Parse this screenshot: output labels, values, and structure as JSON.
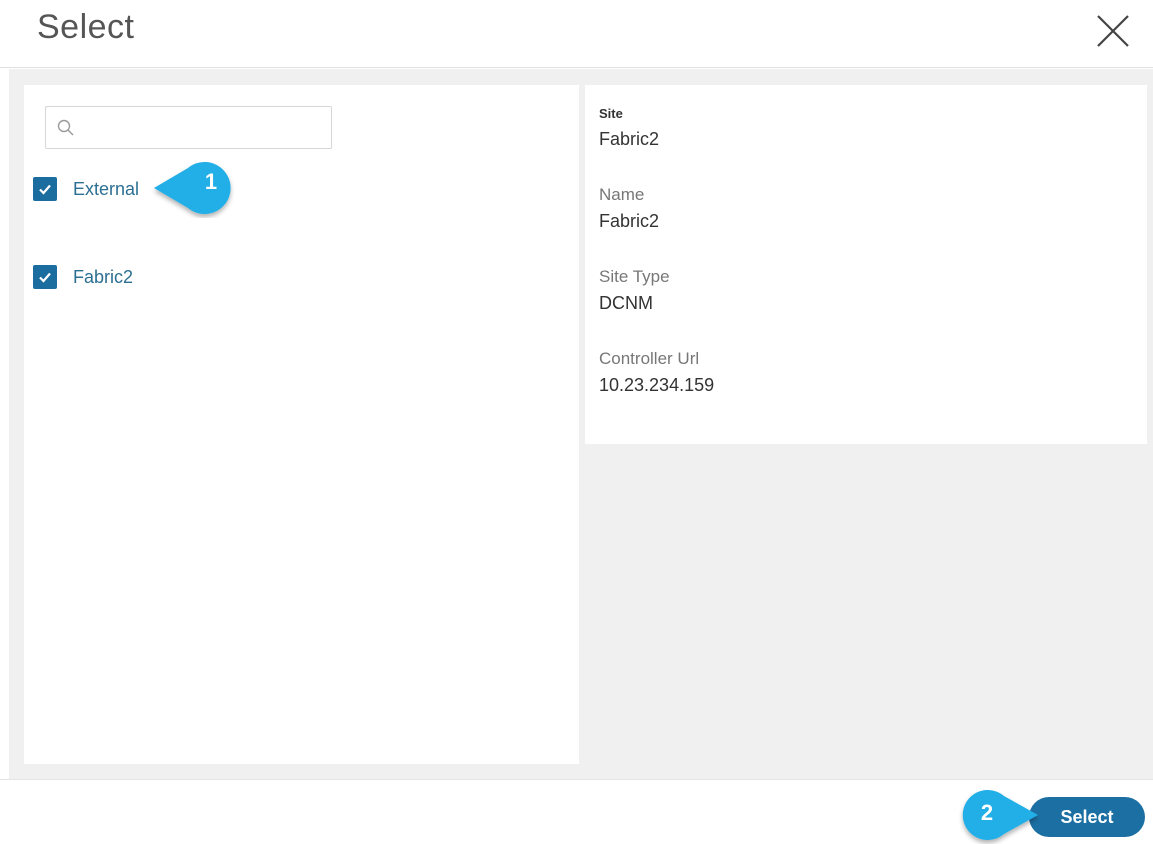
{
  "dialog": {
    "title": "Select",
    "close_icon": "close-icon"
  },
  "search": {
    "placeholder": "",
    "value": "",
    "icon": "search-icon"
  },
  "sites_list": [
    {
      "label": "External",
      "checked": true
    },
    {
      "label": "Fabric2",
      "checked": true
    }
  ],
  "details": {
    "site_label": "Site",
    "site_value": "Fabric2",
    "name_label": "Name",
    "name_value": "Fabric2",
    "site_type_label": "Site Type",
    "site_type_value": "DCNM",
    "controller_url_label": "Controller Url",
    "controller_url_value": "10.23.234.159"
  },
  "footer": {
    "select_label": "Select"
  },
  "callouts": [
    {
      "number": "1"
    },
    {
      "number": "2"
    }
  ],
  "colors": {
    "primary": "#1c6fa3",
    "checkbox": "#1b6d9f",
    "link_text": "#2b6f93",
    "callout": "#22aee6"
  }
}
